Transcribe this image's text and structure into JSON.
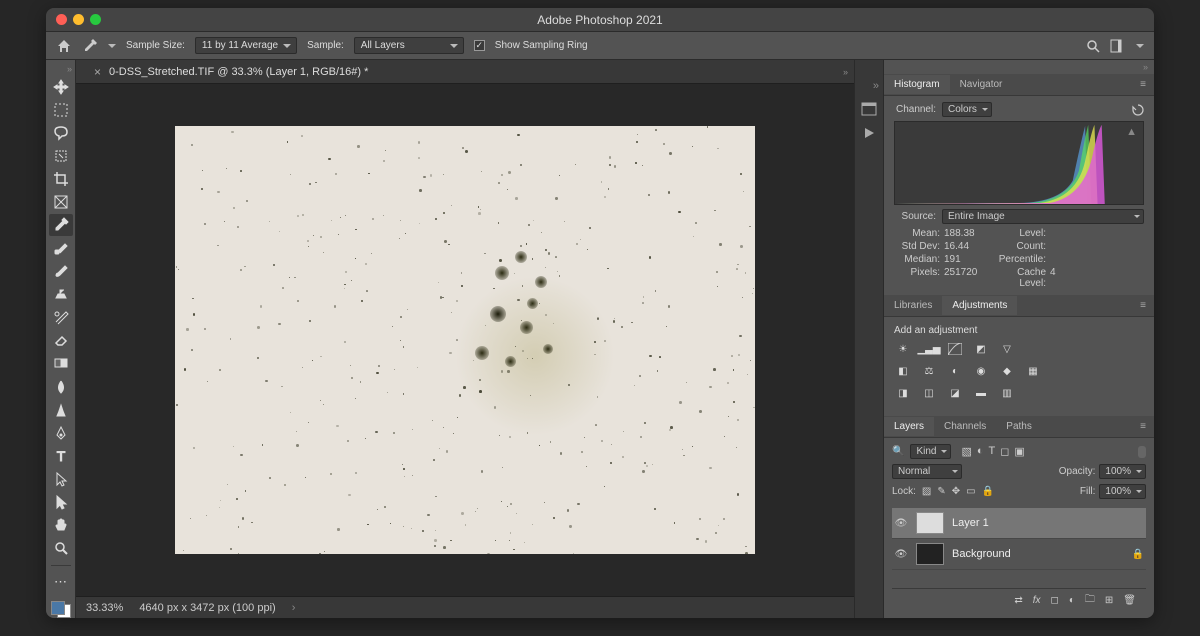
{
  "app_title": "Adobe Photoshop 2021",
  "options_bar": {
    "sample_size_label": "Sample Size:",
    "sample_size_value": "11 by 11 Average",
    "sample_label": "Sample:",
    "sample_value": "All Layers",
    "show_sampling_ring": "Show Sampling Ring"
  },
  "document": {
    "tab_title": "0-DSS_Stretched.TIF @ 33.3% (Layer 1, RGB/16#) *"
  },
  "status": {
    "zoom": "33.33%",
    "doc_info": "4640 px x 3472 px (100 ppi)"
  },
  "histogram": {
    "tab1": "Histogram",
    "tab2": "Navigator",
    "channel_label": "Channel:",
    "channel_value": "Colors",
    "source_label": "Source:",
    "source_value": "Entire Image",
    "stats": {
      "mean_l": "Mean:",
      "mean_v": "188.38",
      "std_l": "Std Dev:",
      "std_v": "16.44",
      "median_l": "Median:",
      "median_v": "191",
      "pixels_l": "Pixels:",
      "pixels_v": "251720",
      "level_l": "Level:",
      "level_v": "",
      "count_l": "Count:",
      "count_v": "",
      "perc_l": "Percentile:",
      "perc_v": "",
      "cache_l": "Cache Level:",
      "cache_v": "4"
    }
  },
  "adjustments": {
    "tab1": "Libraries",
    "tab2": "Adjustments",
    "title": "Add an adjustment"
  },
  "layers": {
    "tab1": "Layers",
    "tab2": "Channels",
    "tab3": "Paths",
    "filter": "Kind",
    "blend_mode": "Normal",
    "opacity_label": "Opacity:",
    "opacity_value": "100%",
    "lock_label": "Lock:",
    "fill_label": "Fill:",
    "fill_value": "100%",
    "items": [
      {
        "name": "Layer 1",
        "visible": true,
        "selected": true
      },
      {
        "name": "Background",
        "visible": true,
        "locked": true
      }
    ]
  }
}
